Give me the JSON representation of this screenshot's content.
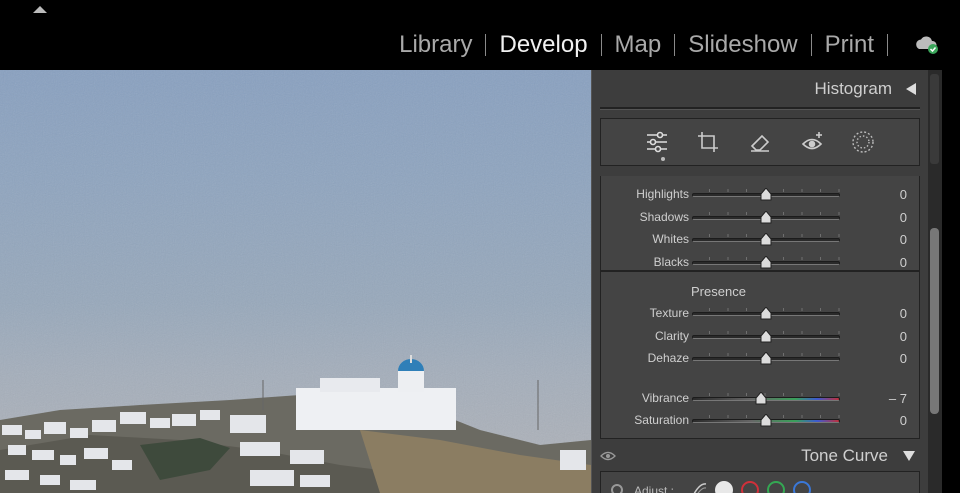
{
  "modules": {
    "library": "Library",
    "develop": "Develop",
    "map": "Map",
    "slideshow": "Slideshow",
    "print": "Print"
  },
  "active_module": "Develop",
  "histogram": {
    "title": "Histogram"
  },
  "tools": [
    "edit-sliders",
    "crop",
    "healing",
    "red-eye",
    "masking"
  ],
  "basic_rows": [
    {
      "label": "Highlights",
      "value": "0",
      "level": 0.5
    },
    {
      "label": "Shadows",
      "value": "0",
      "level": 0.5
    },
    {
      "label": "Whites",
      "value": "0",
      "level": 0.5
    },
    {
      "label": "Blacks",
      "value": "0",
      "level": 0.5
    }
  ],
  "presence": {
    "title": "Presence",
    "rows": [
      {
        "label": "Texture",
        "value": "0",
        "level": 0.5
      },
      {
        "label": "Clarity",
        "value": "0",
        "level": 0.5
      },
      {
        "label": "Dehaze",
        "value": "0",
        "level": 0.5
      },
      {
        "label": "Vibrance",
        "value": "– 7",
        "level": 0.465,
        "color": true
      },
      {
        "label": "Saturation",
        "value": "0",
        "level": 0.5,
        "color": true
      }
    ]
  },
  "tone_curve": {
    "title": "Tone Curve",
    "adjust_label": "Adjust :"
  },
  "channel_colors": {
    "white": "#e8e8e8",
    "red": "#d0303a",
    "green": "#34a853",
    "blue": "#3a78d8"
  },
  "colors": {
    "panel_bg": "#3d3d3d",
    "section_bg": "#444444",
    "active_text": "#f1f1f1",
    "inactive_text": "#a9a9a9"
  }
}
